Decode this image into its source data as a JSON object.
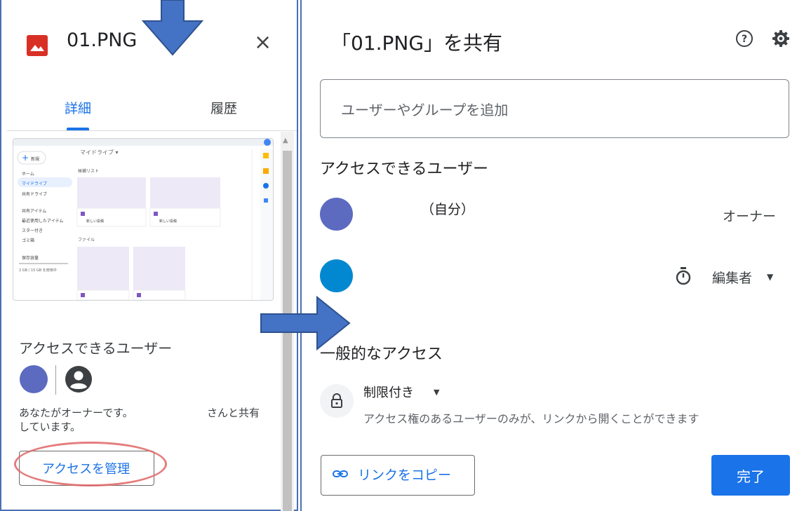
{
  "left": {
    "file_name": "01.PNG",
    "close_symbol": "×",
    "tabs": [
      {
        "label": "詳細"
      },
      {
        "label": "履歴"
      }
    ],
    "access_heading": "アクセスできるユーザー",
    "owner_note_line1": "あなたがオーナーです。",
    "owner_note_line2": "しています。",
    "shared_with_suffix": "さんと共有",
    "manage_access_label": "アクセスを管理",
    "thumbnail": {
      "new_label": "新規",
      "breadcrumb": "マイドライブ ▾",
      "sidebar_items": [
        "ホーム",
        "マイドライブ",
        "共有ドライブ",
        "共有アイテム",
        "最近使用したアイテム",
        "スター付き",
        "ゴミ箱",
        "保存容量"
      ],
      "section_label": "候補リスト",
      "files_label": "ファイル",
      "storage_text": "2 GB / 15 GB を使用中",
      "card_label": "新しい投稿"
    }
  },
  "right": {
    "title": "「01.PNG」を共有",
    "add_placeholder": "ユーザーやグループを追加",
    "people_heading": "アクセスできるユーザー",
    "people": [
      {
        "name_suffix": "（自分）",
        "role": "オーナー",
        "avatar_color": "#5c6bc0"
      },
      {
        "name_suffix": "",
        "role": "編集者",
        "avatar_color": "#0288d1"
      }
    ],
    "general_access_heading": "一般的なアクセス",
    "restriction_label": "制限付き",
    "restriction_desc": "アクセス権のあるユーザーのみが、リンクから開くことができます",
    "copy_link_label": "リンクをコピー",
    "done_label": "完了"
  },
  "colors": {
    "accent": "#1a73e8",
    "arrow": "#4472c4",
    "highlight_ring": "#e06666",
    "file_icon": "#d93025"
  }
}
